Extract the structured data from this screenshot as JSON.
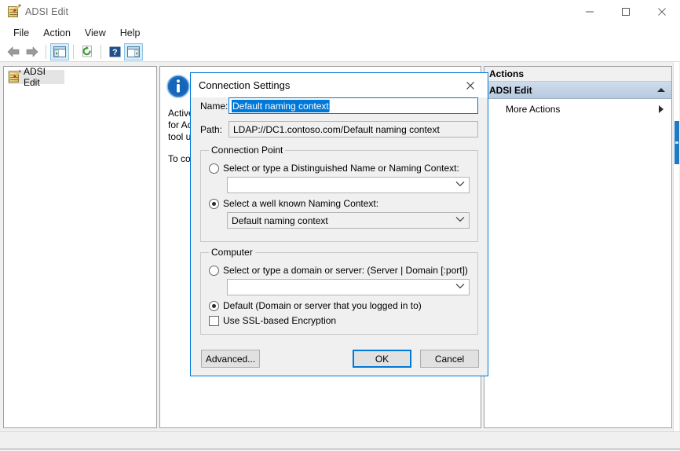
{
  "window": {
    "title": "ADSI Edit",
    "icon": "adsi-edit-icon",
    "controls": {
      "minimize": "Minimize",
      "maximize": "Maximize",
      "close": "Close"
    }
  },
  "menu": {
    "items": [
      {
        "label": "File"
      },
      {
        "label": "Action"
      },
      {
        "label": "View"
      },
      {
        "label": "Help"
      }
    ]
  },
  "toolbar": {
    "buttons": [
      {
        "name": "back-arrow-icon",
        "label": "Back"
      },
      {
        "name": "forward-arrow-icon",
        "label": "Forward"
      },
      {
        "name": "show-hide-console-tree-icon",
        "label": "Show/Hide Console Tree"
      },
      {
        "name": "refresh-icon",
        "label": "Refresh"
      },
      {
        "name": "help-icon",
        "label": "Help"
      },
      {
        "name": "show-hide-action-pane-icon",
        "label": "Show/Hide Action Pane"
      }
    ]
  },
  "tree": {
    "items": [
      {
        "label": "ADSI Edit",
        "icon": "adsi-edit-icon",
        "selected": true
      }
    ]
  },
  "main": {
    "icon": "info-icon",
    "paragraphs": [
      "Active Directory Service Interfaces Editor (ADSI Edit) is a low level editor for Active Directory. It is a Lightweight Directory Access Protocol (LDAP) tool used to create, view and modify objects and attributes.",
      "To connect to a naming context, on the Action menu, click Connect to."
    ]
  },
  "actions": {
    "header": "Actions",
    "group_label": "ADSI Edit",
    "group_collapse_icon": "caret-up-icon",
    "items": [
      {
        "label": "More Actions",
        "submenu_icon": "caret-right-icon"
      }
    ]
  },
  "dialog": {
    "title": "Connection Settings",
    "close_icon": "close-icon",
    "name": {
      "label": "Name:",
      "value": "Default naming context",
      "selected": true
    },
    "path": {
      "label": "Path:",
      "value": "LDAP://DC1.contoso.com/Default naming context",
      "readonly": true
    },
    "connection_point": {
      "legend": "Connection Point",
      "option_dn": {
        "label": "Select or type a Distinguished Name or Naming Context:",
        "selected": false,
        "combo_value": "",
        "combo_placeholder": ""
      },
      "option_well_known": {
        "label": "Select a well known Naming Context:",
        "selected": true,
        "combo_value": "Default naming context"
      }
    },
    "computer": {
      "legend": "Computer",
      "option_server": {
        "label": "Select or type a domain or server: (Server | Domain [:port])",
        "selected": false,
        "combo_value": ""
      },
      "option_default": {
        "label": "Default (Domain or server that you logged in to)",
        "selected": true
      },
      "ssl_checkbox": {
        "label": "Use SSL-based Encryption",
        "checked": false
      }
    },
    "buttons": {
      "advanced": "Advanced...",
      "ok": "OK",
      "cancel": "Cancel"
    }
  },
  "colors": {
    "accent": "#0078d7",
    "actions_group_bg": "#b7cade",
    "toolbar_framed": "#d9ecf7",
    "scrollbar_thumb": "#1e7ac4"
  }
}
